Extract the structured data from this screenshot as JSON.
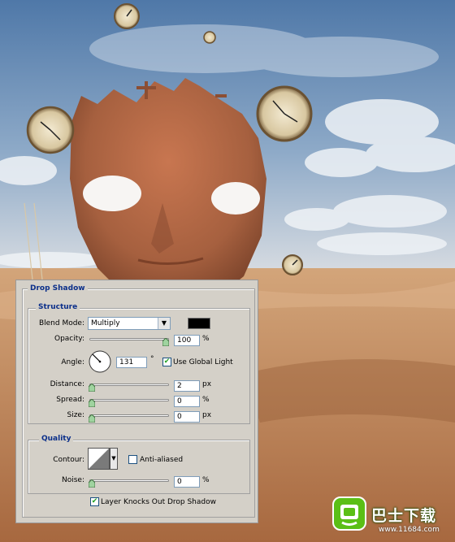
{
  "dialog": {
    "section_title": "Drop Shadow",
    "structure": {
      "title": "Structure",
      "blend_mode_label": "Blend Mode:",
      "blend_mode_value": "Multiply",
      "shadow_color": "#000000",
      "opacity_label": "Opacity:",
      "opacity_value": "100",
      "opacity_unit": "%",
      "opacity_slider_level": 1.0,
      "angle_label": "Angle:",
      "angle_value": "131",
      "angle_unit": "°",
      "use_global_light_label": "Use Global Light",
      "use_global_light_checked": true,
      "distance_label": "Distance:",
      "distance_value": "2",
      "distance_unit": "px",
      "spread_label": "Spread:",
      "spread_value": "0",
      "spread_unit": "%",
      "size_label": "Size:",
      "size_value": "0",
      "size_unit": "px"
    },
    "quality": {
      "title": "Quality",
      "contour_label": "Contour:",
      "anti_aliased_label": "Anti-aliased",
      "anti_aliased_checked": false,
      "noise_label": "Noise:",
      "noise_value": "0",
      "noise_unit": "%"
    },
    "layer_knocks_out_label": "Layer Knocks Out Drop Shadow",
    "layer_knocks_out_checked": true
  },
  "watermark": {
    "brand": "巴士下载",
    "url": "www.11684.com",
    "accent": "#5bbf16"
  },
  "background": {
    "sky_top": "#5a82b0",
    "sky_bottom": "#c9d6e2",
    "sand": "#c08a5e",
    "mask_color": "#b06a48"
  }
}
